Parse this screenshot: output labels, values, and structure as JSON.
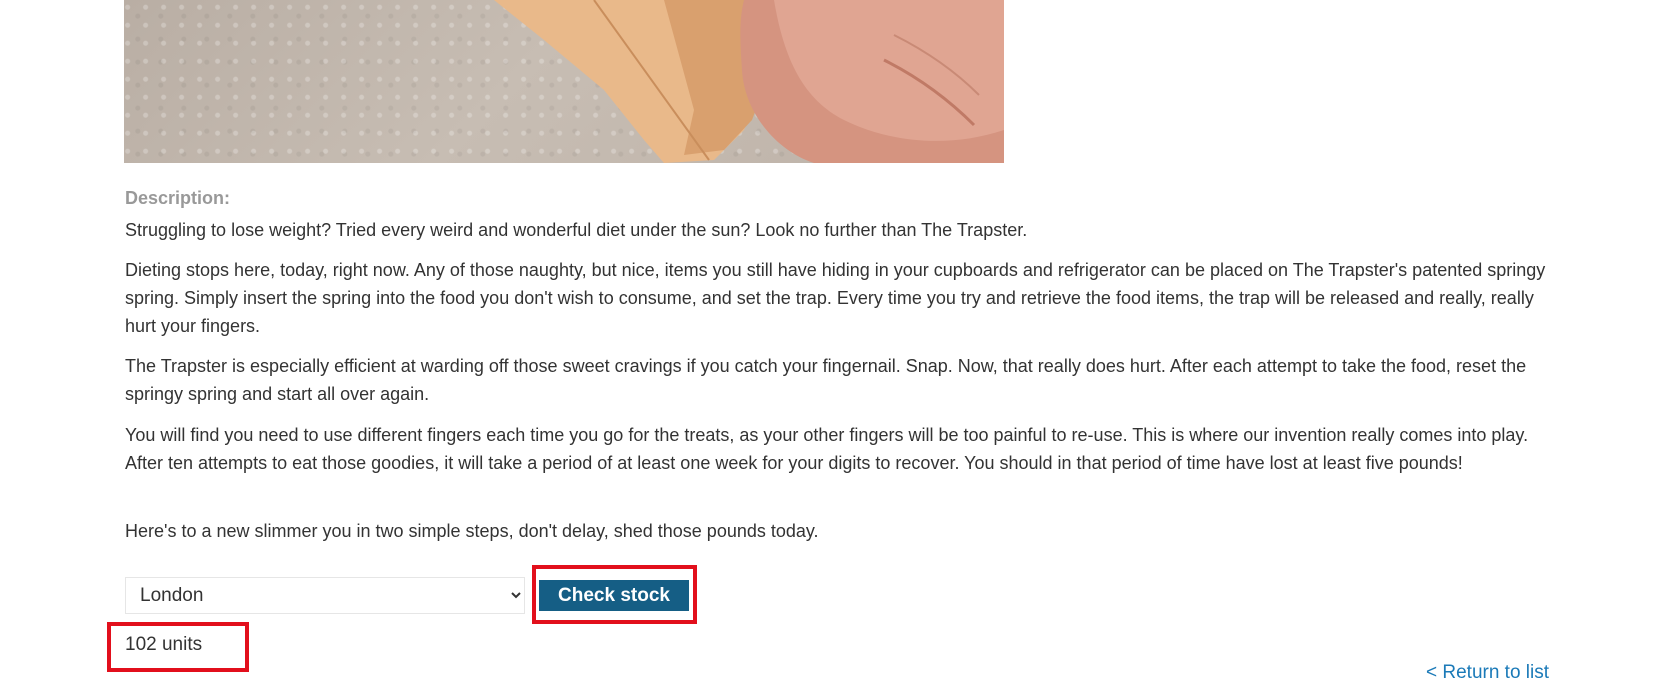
{
  "product": {
    "image_alt": "The Trapster product photo"
  },
  "description": {
    "label": "Description:",
    "paragraphs": [
      "Struggling to lose weight? Tried every weird and wonderful diet under the sun? Look no further than The Trapster.",
      "Dieting stops here, today, right now. Any of those naughty, but nice, items you still have hiding in your cupboards and refrigerator can be placed on The Trapster's patented springy spring. Simply insert the spring into the food you don't wish to consume, and set the trap. Every time you try and retrieve the food items, the trap will be released and really, really hurt your fingers.",
      "The Trapster is especially efficient at warding off those sweet cravings if you catch your fingernail. Snap. Now, that really does hurt. After each attempt to take the food, reset the springy spring and start all over again.",
      "You will find you need to use different fingers each time you go for the treats, as your other fingers will be too painful to re-use. This is where our invention really comes into play. After ten attempts to eat those goodies, it will take a period of at least one week for your digits to recover. You should in that period of time have lost at least five pounds!",
      "Here's to a new slimmer you in two simple steps, don't delay, shed those pounds today."
    ]
  },
  "stock_check": {
    "selected_store": "London",
    "button_label": "Check stock",
    "result": "102 units"
  },
  "navigation": {
    "return_link": "< Return to list"
  },
  "colors": {
    "button_bg": "#155e85",
    "highlight": "#e20f1c",
    "link": "#1b7ab8"
  },
  "icons": {
    "select_chevron": "chevron-down-icon"
  }
}
